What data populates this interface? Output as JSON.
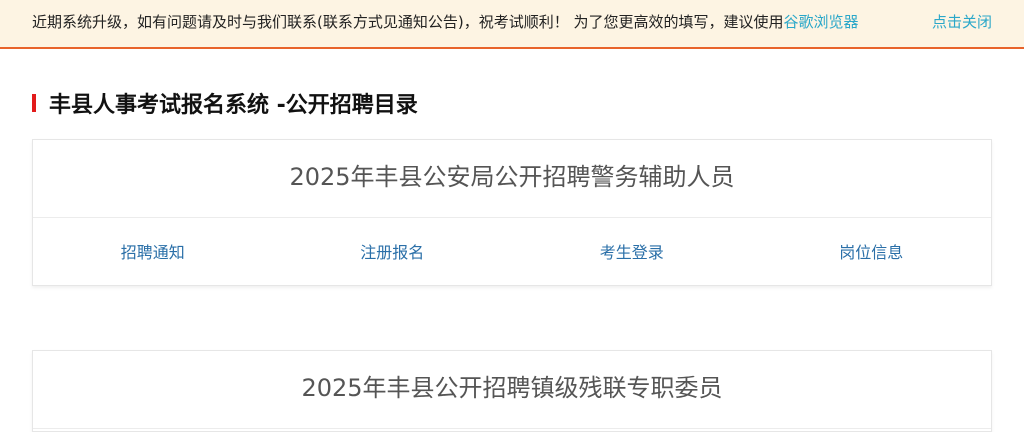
{
  "notice": {
    "text": "近期系统升级，如有问题请及时与我们联系(联系方式见通知公告)，祝考试顺利！ 为了您更高效的填写，建议使用",
    "browser_link": "谷歌浏览器",
    "close_label": "点击关闭",
    "bar_color": "#fdf4e3",
    "border_color": "#e8632b",
    "link_color": "#2aa7c9"
  },
  "section": {
    "title": "丰县人事考试报名系统 -公开招聘目录",
    "marker_color": "#e21b1b"
  },
  "recruitments": [
    {
      "title": "2025年丰县公安局公开招聘警务辅助人员",
      "links": [
        "招聘通知",
        "注册报名",
        "考生登录",
        "岗位信息"
      ]
    },
    {
      "title": "2025年丰县公开招聘镇级残联专职委员"
    }
  ]
}
